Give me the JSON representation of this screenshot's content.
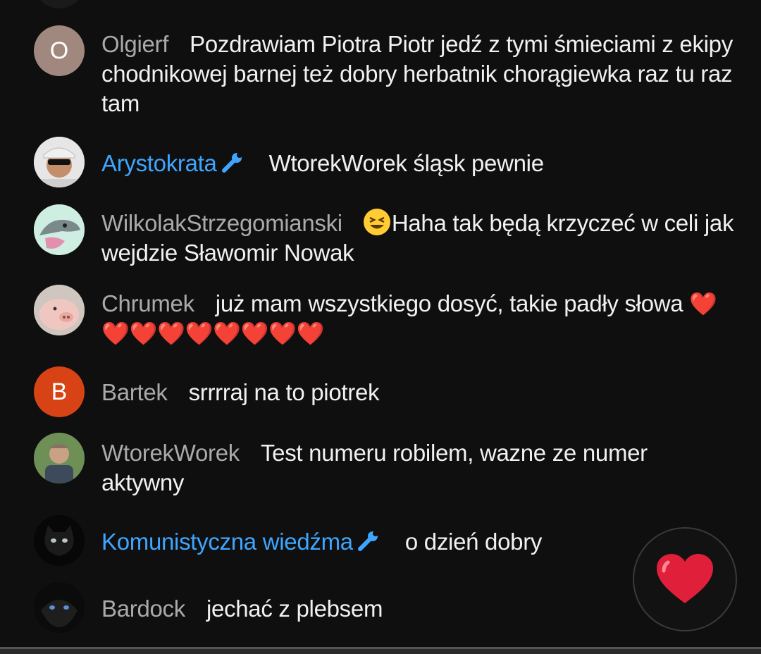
{
  "chat": {
    "messages": [
      {
        "author": "Olgierf",
        "avatar_letter": "O",
        "avatar_color": "#a1887f",
        "text": "Pozdrawiam Piotra Piotr jedź z tymi śmieciami z ekipy chodnikowej barnej też dobry herbatnik chorągiewka raz tu raz tam"
      },
      {
        "author": "Arystokrata",
        "is_moderator": true,
        "avatar": "photo-man-sunglasses",
        "text": "WtorekWorek śląsk pewnie"
      },
      {
        "author": "WilkolakStrzegomianski",
        "avatar": "cartoon-wolf",
        "emoji": "laughing-face-emoji",
        "text": "Haha tak będą krzyczeć w celi jak wejdzie Sławomir Nowak"
      },
      {
        "author": "Chrumek",
        "avatar": "pig-photo",
        "text": "już mam wszystkiego dosyć, takie padły słowa",
        "hearts": "❤️❤️❤️❤️❤️❤️❤️❤️❤️"
      },
      {
        "author": "Bartek",
        "avatar_letter": "B",
        "avatar_color": "#d84315",
        "text": "srrrraj na to piotrek"
      },
      {
        "author": "WtorekWorek",
        "avatar": "photo-man-outdoors",
        "text": "Test numeru robilem, wazne ze numer aktywny"
      },
      {
        "author": "Komunistyczna wiedźma",
        "is_moderator": true,
        "avatar": "black-cat-photo",
        "text": "o dzień dobry"
      },
      {
        "author": "Bardock",
        "avatar": "dark-panther-photo",
        "text": "jechać z plebsem"
      }
    ]
  },
  "reaction_button": {
    "icon": "red-heart-icon"
  },
  "colors": {
    "background": "#0f0f0f",
    "author_regular": "#aaaaaa",
    "author_moderator": "#3ea6ff",
    "message_text": "#f1f1f1",
    "heart": "#e0203a"
  }
}
